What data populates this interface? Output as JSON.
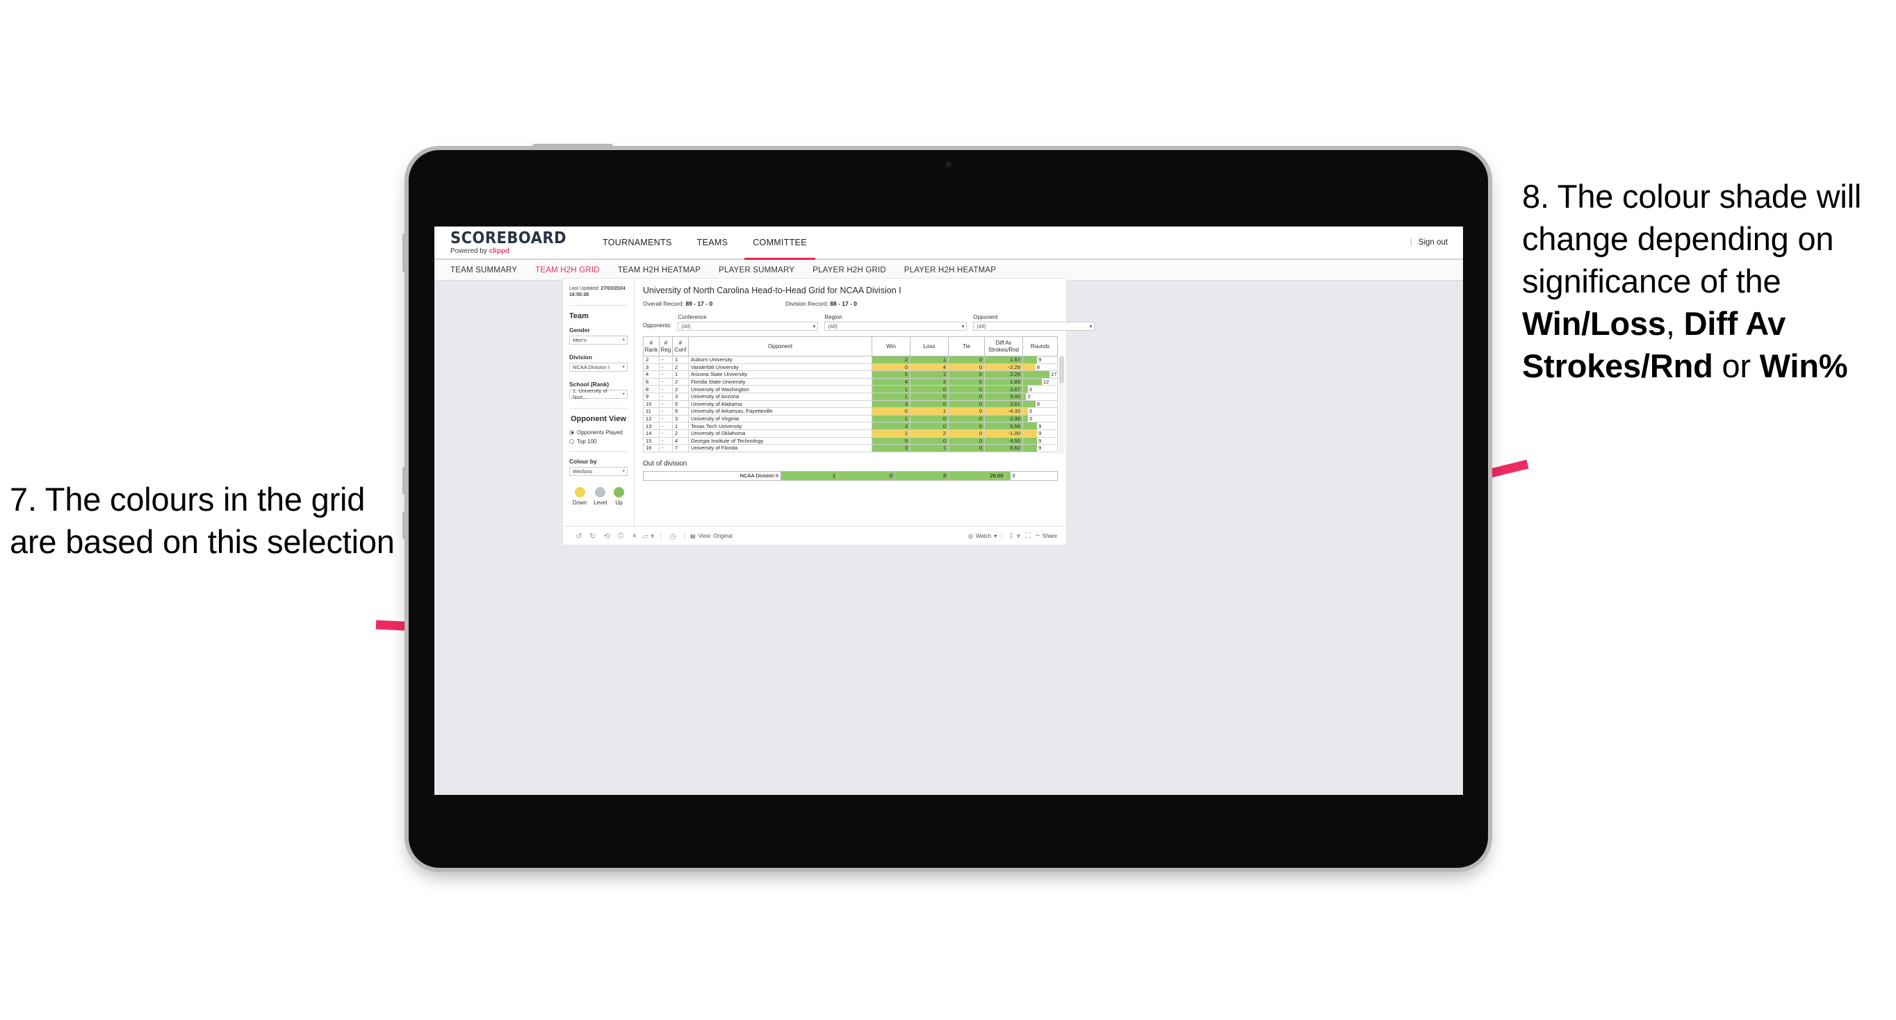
{
  "annotations": {
    "left": "7. The colours in the grid are based on this selection",
    "right_pre": "8. The colour shade will change depending on significance of the ",
    "right_b1": "Win/Loss",
    "right_mid1": ", ",
    "right_b2": "Diff Av Strokes/Rnd",
    "right_mid2": " or ",
    "right_b3": "Win%",
    "arrow_color": "#ED2B63"
  },
  "app": {
    "brand_title": "SCOREBOARD",
    "brand_sub_prefix": "Powered by ",
    "brand_sub_name": "clippd",
    "top_nav": [
      {
        "label": "TOURNAMENTS",
        "active": false
      },
      {
        "label": "TEAMS",
        "active": false
      },
      {
        "label": "COMMITTEE",
        "active": true
      }
    ],
    "sign_out": "Sign out",
    "sub_nav": [
      {
        "label": "TEAM SUMMARY",
        "active": false
      },
      {
        "label": "TEAM H2H GRID",
        "active": true
      },
      {
        "label": "TEAM H2H HEATMAP",
        "active": false
      },
      {
        "label": "PLAYER SUMMARY",
        "active": false
      },
      {
        "label": "PLAYER H2H GRID",
        "active": false
      },
      {
        "label": "PLAYER H2H HEATMAP",
        "active": false
      }
    ],
    "accent": "#E8315C"
  },
  "panel": {
    "last_updated_label": "Last Updated:",
    "last_updated_value": "27/03/2024 16:55:38",
    "team_heading": "Team",
    "gender_label": "Gender",
    "gender_value": "Men's",
    "division_label": "Division",
    "division_value": "NCAA Division I",
    "school_label": "School (Rank)",
    "school_value": "1. University of Nort...",
    "opponent_view_heading": "Opponent View",
    "radio_opponents_played": "Opponents Played",
    "radio_top_100": "Top 100",
    "colour_by_label": "Colour by",
    "colour_by_value": "Win/loss",
    "legend": [
      {
        "label": "Down",
        "color": "#F2D65B"
      },
      {
        "label": "Level",
        "color": "#BFC2C7"
      },
      {
        "label": "Up",
        "color": "#86C05A"
      }
    ]
  },
  "viz": {
    "title": "University of North Carolina Head-to-Head Grid for NCAA Division I",
    "overall_record_label": "Overall Record:",
    "overall_record_value": "89 - 17 - 0",
    "division_record_label": "Division Record:",
    "division_record_value": "88 - 17 - 0",
    "opponents_lead": "Opponents:",
    "filters": [
      {
        "label": "Conference",
        "value": "(All)"
      },
      {
        "label": "Region",
        "value": "(All)"
      },
      {
        "label": "Opponent",
        "value": "(All)"
      }
    ],
    "out_of_division_title": "Out of division",
    "toolbar": {
      "view_label": "View: Original",
      "watch_label": "Watch",
      "share_label": "Share"
    }
  },
  "chart_data": {
    "type": "table",
    "title": "University of North Carolina Head-to-Head Grid for NCAA Division I",
    "columns": [
      "# Rank",
      "# Reg",
      "# Conf",
      "Opponent",
      "Win",
      "Loss",
      "Tie",
      "Diff Av Strokes/Rnd",
      "Rounds"
    ],
    "column_headers_two_line": [
      {
        "l1": "#",
        "l2": "Rank"
      },
      {
        "l1": "#",
        "l2": "Reg"
      },
      {
        "l1": "#",
        "l2": "Conf"
      },
      {
        "l1": "Opponent",
        "l2": ""
      },
      {
        "l1": "Win",
        "l2": ""
      },
      {
        "l1": "Loss",
        "l2": ""
      },
      {
        "l1": "Tie",
        "l2": ""
      },
      {
        "l1": "Diff Av",
        "l2": "Strokes/Rnd"
      },
      {
        "l1": "Rounds",
        "l2": ""
      }
    ],
    "rounds_max": 17,
    "colors": {
      "up": "#8EC866",
      "down": "#F3D35D",
      "level": "#BFC2C7"
    },
    "rows": [
      {
        "rank": "2",
        "reg": "-",
        "conf": "1",
        "opponent": "Auburn University",
        "win": "2",
        "loss": "1",
        "tie": "0",
        "diff": "1.67",
        "rounds": "9",
        "state": "up"
      },
      {
        "rank": "3",
        "reg": "-",
        "conf": "2",
        "opponent": "Vanderbilt University",
        "win": "0",
        "loss": "4",
        "tie": "0",
        "diff": "-2.29",
        "rounds": "8",
        "state": "down"
      },
      {
        "rank": "4",
        "reg": "-",
        "conf": "1",
        "opponent": "Arizona State University",
        "win": "5",
        "loss": "1",
        "tie": "0",
        "diff": "2.28",
        "rounds": "17",
        "state": "up"
      },
      {
        "rank": "6",
        "reg": "-",
        "conf": "2",
        "opponent": "Florida State University",
        "win": "4",
        "loss": "2",
        "tie": "0",
        "diff": "1.83",
        "rounds": "12",
        "state": "up"
      },
      {
        "rank": "8",
        "reg": "-",
        "conf": "2",
        "opponent": "University of Washington",
        "win": "1",
        "loss": "0",
        "tie": "0",
        "diff": "3.67",
        "rounds": "3",
        "state": "up"
      },
      {
        "rank": "9",
        "reg": "-",
        "conf": "3",
        "opponent": "University of Arizona",
        "win": "1",
        "loss": "0",
        "tie": "0",
        "diff": "9.00",
        "rounds": "2",
        "state": "up"
      },
      {
        "rank": "10",
        "reg": "-",
        "conf": "5",
        "opponent": "University of Alabama",
        "win": "3",
        "loss": "0",
        "tie": "0",
        "diff": "2.61",
        "rounds": "8",
        "state": "up"
      },
      {
        "rank": "11",
        "reg": "-",
        "conf": "6",
        "opponent": "University of Arkansas, Fayetteville",
        "win": "0",
        "loss": "1",
        "tie": "0",
        "diff": "-4.33",
        "rounds": "3",
        "state": "down"
      },
      {
        "rank": "12",
        "reg": "-",
        "conf": "3",
        "opponent": "University of Virginia",
        "win": "1",
        "loss": "0",
        "tie": "0",
        "diff": "2.33",
        "rounds": "3",
        "state": "up"
      },
      {
        "rank": "13",
        "reg": "-",
        "conf": "1",
        "opponent": "Texas Tech University",
        "win": "3",
        "loss": "0",
        "tie": "0",
        "diff": "5.56",
        "rounds": "9",
        "state": "up"
      },
      {
        "rank": "14",
        "reg": "-",
        "conf": "2",
        "opponent": "University of Oklahoma",
        "win": "1",
        "loss": "2",
        "tie": "0",
        "diff": "-1.00",
        "rounds": "9",
        "state": "down"
      },
      {
        "rank": "15",
        "reg": "-",
        "conf": "4",
        "opponent": "Georgia Institute of Technology",
        "win": "5",
        "loss": "0",
        "tie": "0",
        "diff": "4.50",
        "rounds": "9",
        "state": "up"
      },
      {
        "rank": "16",
        "reg": "-",
        "conf": "7",
        "opponent": "University of Florida",
        "win": "3",
        "loss": "1",
        "tie": "0",
        "diff": "6.62",
        "rounds": "9",
        "state": "up"
      }
    ],
    "out_of_division": {
      "label": "NCAA Division II",
      "win": "1",
      "loss": "0",
      "tie": "0",
      "diff": "26.00",
      "rounds": "3",
      "state": "up"
    }
  }
}
